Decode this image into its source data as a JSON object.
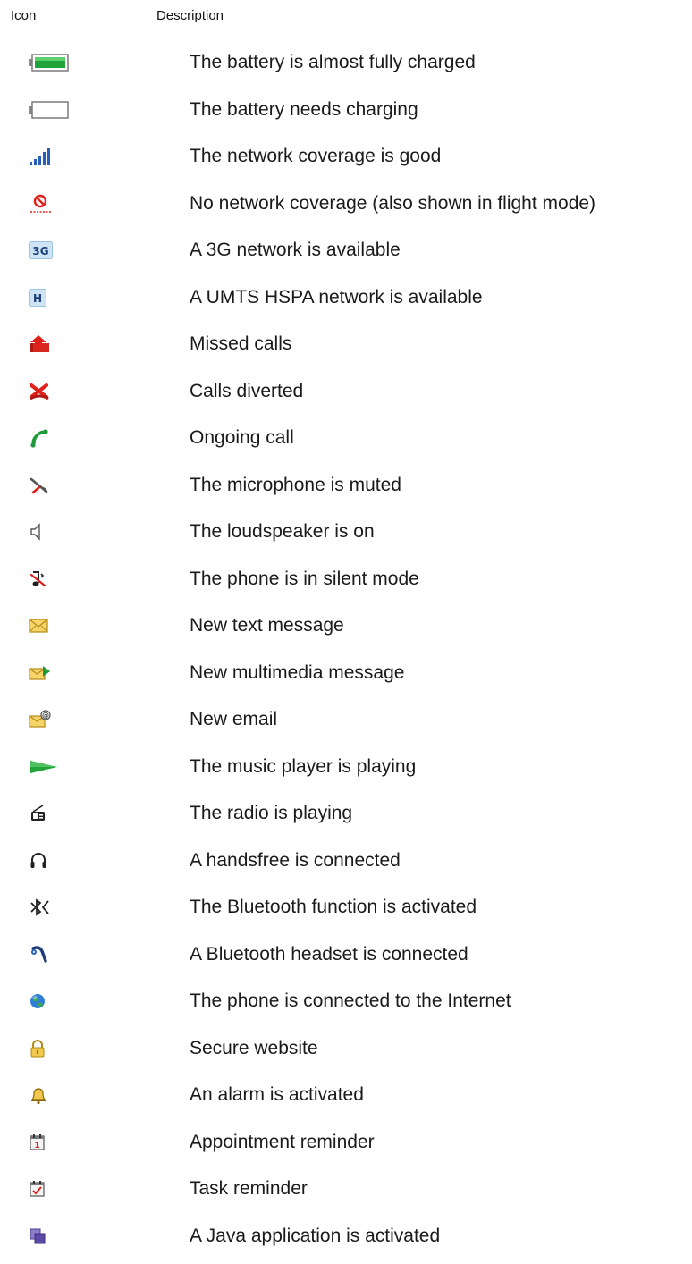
{
  "header": {
    "icon_label": "Icon",
    "description_label": "Description"
  },
  "rows": [
    {
      "icon": "battery-full-icon",
      "text": "The battery is almost fully charged"
    },
    {
      "icon": "battery-empty-icon",
      "text": "The battery needs charging"
    },
    {
      "icon": "signal-bars-icon",
      "text": "The network coverage is good"
    },
    {
      "icon": "no-network-icon",
      "text": "No network coverage (also shown in flight mode)"
    },
    {
      "icon": "3g-icon",
      "text": "A 3G network is available"
    },
    {
      "icon": "hspa-icon",
      "text": "A UMTS HSPA network is available"
    },
    {
      "icon": "missed-call-icon",
      "text": "Missed calls"
    },
    {
      "icon": "call-divert-icon",
      "text": "Calls diverted"
    },
    {
      "icon": "ongoing-call-icon",
      "text": "Ongoing call"
    },
    {
      "icon": "mic-muted-icon",
      "text": "The microphone is muted"
    },
    {
      "icon": "loudspeaker-icon",
      "text": "The loudspeaker is on"
    },
    {
      "icon": "silent-mode-icon",
      "text": "The phone is in silent mode"
    },
    {
      "icon": "envelope-icon",
      "text": "New text message"
    },
    {
      "icon": "multimedia-message-icon",
      "text": "New multimedia message"
    },
    {
      "icon": "email-icon",
      "text": "New email"
    },
    {
      "icon": "play-icon",
      "text": "The music player is playing"
    },
    {
      "icon": "radio-icon",
      "text": "The radio is playing"
    },
    {
      "icon": "handsfree-icon",
      "text": "A handsfree is connected"
    },
    {
      "icon": "bluetooth-icon",
      "text": "The Bluetooth function is activated"
    },
    {
      "icon": "bluetooth-headset-icon",
      "text": "A Bluetooth headset is connected"
    },
    {
      "icon": "globe-icon",
      "text": "The phone is connected to the Internet"
    },
    {
      "icon": "lock-icon",
      "text": "Secure website"
    },
    {
      "icon": "alarm-bell-icon",
      "text": "An alarm is activated"
    },
    {
      "icon": "calendar-icon",
      "text": "Appointment reminder"
    },
    {
      "icon": "task-icon",
      "text": "Task reminder"
    },
    {
      "icon": "java-app-icon",
      "text": "A Java application is activated"
    }
  ],
  "colors": {
    "text": "#1a1a1a",
    "green": "#22a33a",
    "red": "#e0201b",
    "blue": "#2a5ebd",
    "yellow": "#f2c94c"
  }
}
